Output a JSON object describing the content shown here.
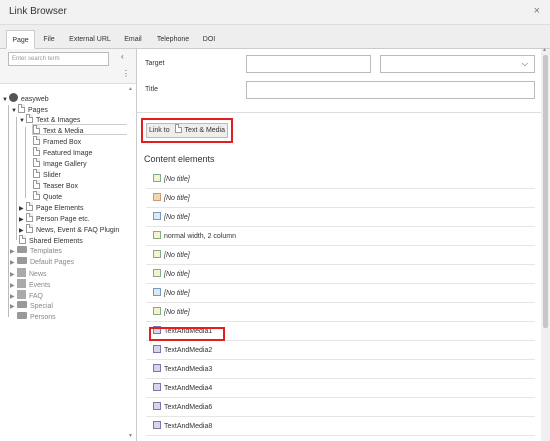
{
  "window": {
    "title": "Link Browser",
    "close": "×"
  },
  "tabs": [
    "Page",
    "File",
    "External URL",
    "Email",
    "Telephone",
    "DOI"
  ],
  "tree": {
    "search_placeholder": "Enter search term",
    "collapse_glyph": "‹",
    "more_glyph": "⋮",
    "caret_open": "▼",
    "caret_closed": "▶",
    "scroll_up": "▲",
    "scroll_down": "▼",
    "nodes": [
      "easyweb",
      "Pages",
      "Text & Images",
      "Text & Media",
      "Framed Box",
      "Featured Image",
      "Image Gallery",
      "Slider",
      "Teaser Box",
      "Quote",
      "Page Elements",
      "Person Page etc.",
      "News, Event & FAQ Plugin",
      "Shared Elements",
      "Templates",
      "Default Pages",
      "News",
      "Events",
      "FAQ",
      "Special",
      "Persons"
    ]
  },
  "form": {
    "target_label": "Target",
    "title_label": "Title",
    "select_arrow": "⌵",
    "link_button": "Link to",
    "link_button_target": "Text & Media"
  },
  "content": {
    "heading": "Content elements",
    "items": [
      "[No title]",
      "[No title]",
      "[No title]",
      "normal width, 2 column",
      "[No title]",
      "[No title]",
      "[No title]",
      "[No title]",
      "TextAndMedia1",
      "TextAndMedia2",
      "TextAndMedia3",
      "TextAndMedia4",
      "TextAndMedia6",
      "TextAndMedia8"
    ]
  }
}
